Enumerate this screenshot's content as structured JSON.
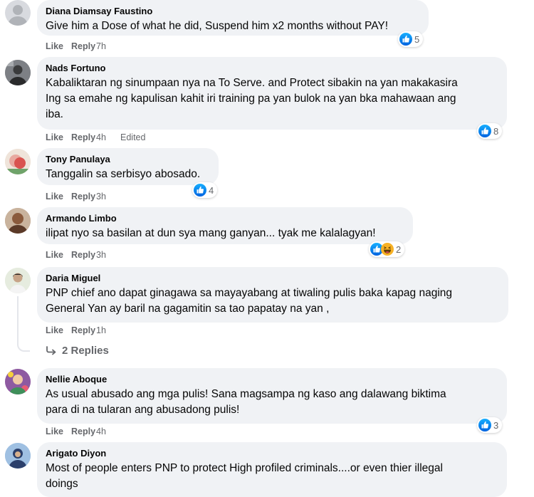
{
  "labels": {
    "like": "Like",
    "reply": "Reply",
    "edited": "Edited"
  },
  "comments": [
    {
      "author": "Diana Diamsay Faustino",
      "text": "Give him a Dose of what he did, Suspend him x2 months without PAY!",
      "time": "7h",
      "reactions": [
        "like-icon"
      ],
      "count": "5"
    },
    {
      "author": "Nads Fortuno",
      "text_lines": [
        "Kabaliktaran ng sinumpaan nya na To Serve. and Protect sibakin na yan makakasira",
        "Ing sa emahe ng kapulisan kahit iri training pa yan bulok na yan bka mahawaan ang",
        "iba."
      ],
      "time": "4h",
      "edited": true,
      "reactions": [
        "like-icon"
      ],
      "count": "8"
    },
    {
      "author": "Tony Panulaya",
      "text": "Tanggalin sa serbisyo abosado.",
      "time": "3h",
      "reactions": [
        "like-icon"
      ],
      "count": "4"
    },
    {
      "author": "Armando Limbo",
      "text": "ilipat nyo sa basilan at dun sya mang ganyan... tyak me kalalagyan!",
      "time": "3h",
      "reactions": [
        "like-icon",
        "haha-icon"
      ],
      "count": "2"
    },
    {
      "author": "Daria Miguel",
      "text_lines": [
        "PNP chief ano dapat ginagawa sa mayayabang at tiwaling pulis baka kapag naging",
        "General Yan ay baril na gagamitin sa tao papatay na yan ,"
      ],
      "time": "1h",
      "replies": "2 Replies"
    },
    {
      "author": "Nellie Aboque",
      "text_lines": [
        "As usual abusado ang mga pulis! Sana magsampa ng kaso ang dalawang biktima",
        "para di na tularan ang abusadong pulis!"
      ],
      "time": "4h",
      "reactions": [
        "like-icon"
      ],
      "count": "3"
    },
    {
      "author": "Arigato Diyon",
      "text_lines": [
        "Most of people enters PNP to protect High profiled criminals....or even thier illegal",
        "doings"
      ]
    }
  ],
  "colors": {
    "bubble": "#f0f2f5",
    "meta": "#65676b",
    "like_blue": "#1877f2",
    "haha_yellow": "#f7b125"
  }
}
